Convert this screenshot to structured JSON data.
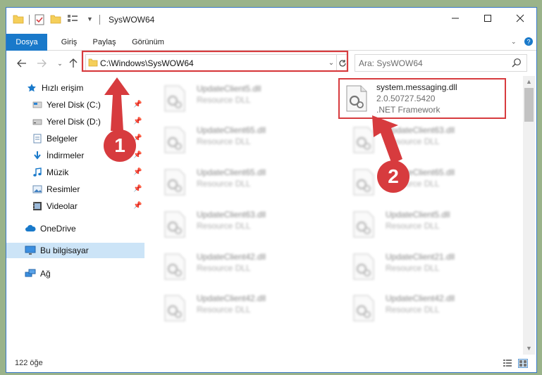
{
  "window": {
    "title": "SysWOW64"
  },
  "ribbon": {
    "tabs": [
      "Dosya",
      "Giriş",
      "Paylaş",
      "Görünüm"
    ]
  },
  "address": {
    "path": "C:\\Windows\\SysWOW64"
  },
  "search": {
    "placeholder": "Ara: SysWOW64"
  },
  "sidebar": {
    "items": [
      {
        "label": "Hızlı erişim",
        "icon": "star-icon"
      },
      {
        "label": "Yerel Disk (C:)",
        "icon": "drive-icon"
      },
      {
        "label": "Yerel Disk (D:)",
        "icon": "drive-icon"
      },
      {
        "label": "Belgeler",
        "icon": "documents-icon"
      },
      {
        "label": "İndirmeler",
        "icon": "download-icon"
      },
      {
        "label": "Müzik",
        "icon": "music-icon"
      },
      {
        "label": "Resimler",
        "icon": "pictures-icon"
      },
      {
        "label": "Videolar",
        "icon": "videos-icon"
      },
      {
        "label": "OneDrive",
        "icon": "cloud-icon"
      },
      {
        "label": "Bu bilgisayar",
        "icon": "computer-icon"
      },
      {
        "label": "Ağ",
        "icon": "network-icon"
      }
    ]
  },
  "files": {
    "highlighted": {
      "name": "system.messaging.dll",
      "version": "2.0.50727.5420",
      "description": ".NET Framework"
    },
    "left_column": [
      {
        "name": "UpdateClient5.dll",
        "type": "Resource DLL"
      },
      {
        "name": "UpdateClient65.dll",
        "type": "Resource DLL"
      },
      {
        "name": "UpdateClient65.dll",
        "type": "Resource DLL"
      },
      {
        "name": "UpdateClient63.dll",
        "type": "Resource DLL"
      },
      {
        "name": "UpdateClient42.dll",
        "type": "Resource DLL"
      },
      {
        "name": "UpdateClient42.dll",
        "type": "Resource DLL"
      }
    ],
    "right_column": [
      {
        "name": "UpdateClient63.dll",
        "type": "Resource DLL"
      },
      {
        "name": "UpdateClient65.dll",
        "type": "Resource DLL"
      },
      {
        "name": "UpdateClient5.dll",
        "type": "Resource DLL"
      },
      {
        "name": "UpdateClient21.dll",
        "type": "Resource DLL"
      },
      {
        "name": "UpdateClient42.dll",
        "type": "Resource DLL"
      }
    ]
  },
  "status": {
    "item_count": "122 öğe"
  },
  "annotations": {
    "step1": "1",
    "step2": "2"
  },
  "colors": {
    "accent": "#1979ca",
    "annotation_red": "#d73b3e",
    "selection": "#cce4f7"
  }
}
